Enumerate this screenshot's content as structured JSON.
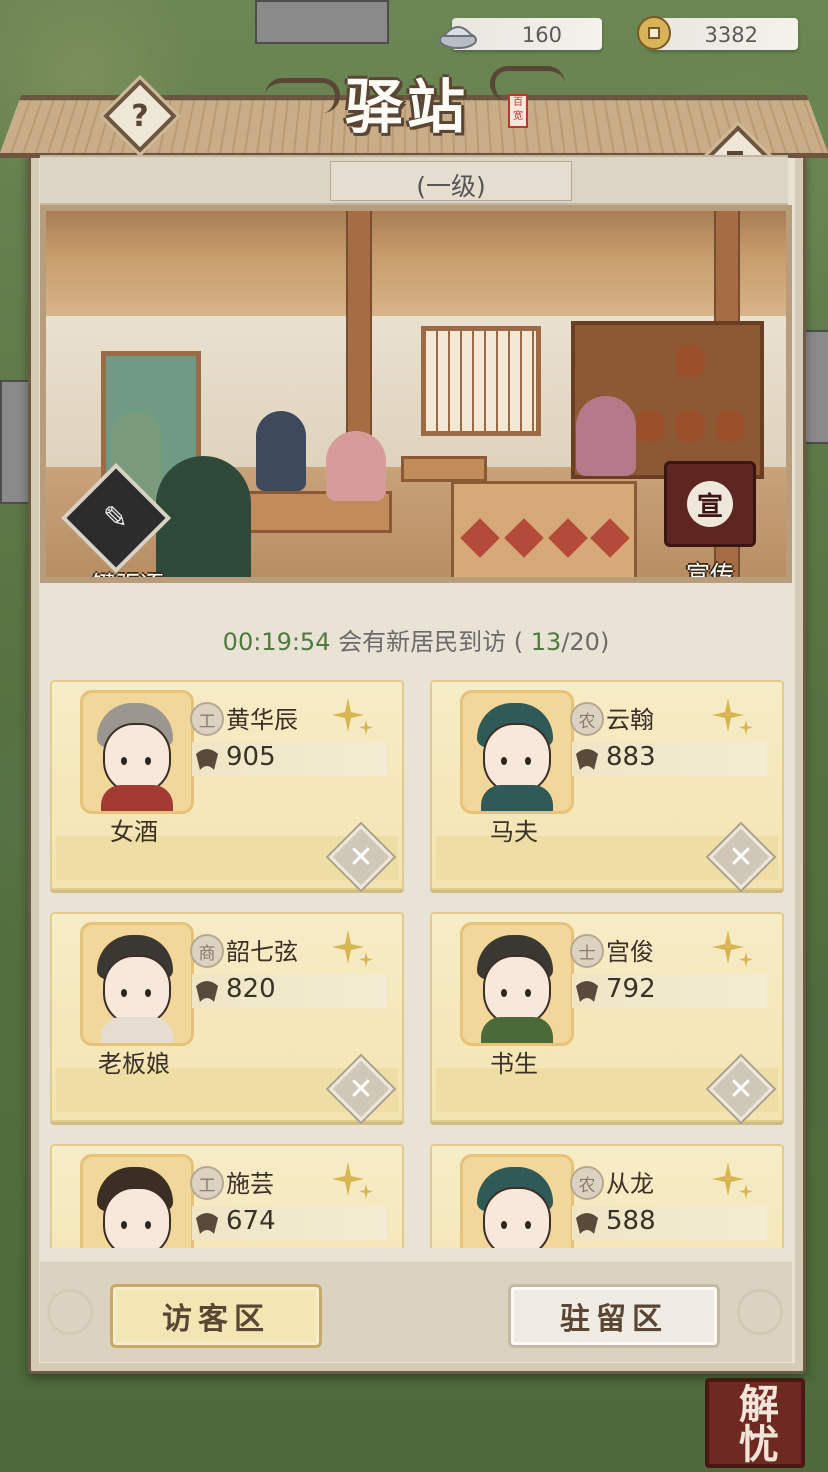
{
  "currency": [
    {
      "name": "silver-ingot",
      "value": "160"
    },
    {
      "name": "copper-coin",
      "value": "3382"
    }
  ],
  "header": {
    "title": "驿站",
    "seal_text": "百宽",
    "help_icon": "?",
    "level": "(一级)"
  },
  "scene": {
    "evict_label": "一键驱逐",
    "promote_label": "宣传",
    "promote_glyph": "宣"
  },
  "timer": {
    "time": "00:19:54",
    "text": "会有新居民到访",
    "current": "13",
    "total": "20"
  },
  "visitors": [
    {
      "badge": "工",
      "name": "黄华辰",
      "stat": "905",
      "role": "女酒"
    },
    {
      "badge": "农",
      "name": "云翰",
      "stat": "883",
      "role": "马夫"
    },
    {
      "badge": "商",
      "name": "韶七弦",
      "stat": "820",
      "role": "老板娘"
    },
    {
      "badge": "士",
      "name": "宫俊",
      "stat": "792",
      "role": "书生"
    },
    {
      "badge": "工",
      "name": "施芸",
      "stat": "674",
      "role": ""
    },
    {
      "badge": "农",
      "name": "从龙",
      "stat": "588",
      "role": ""
    }
  ],
  "tabs": {
    "visitor": "访客区",
    "resident": "驻留区"
  },
  "corner_button": "解忧"
}
